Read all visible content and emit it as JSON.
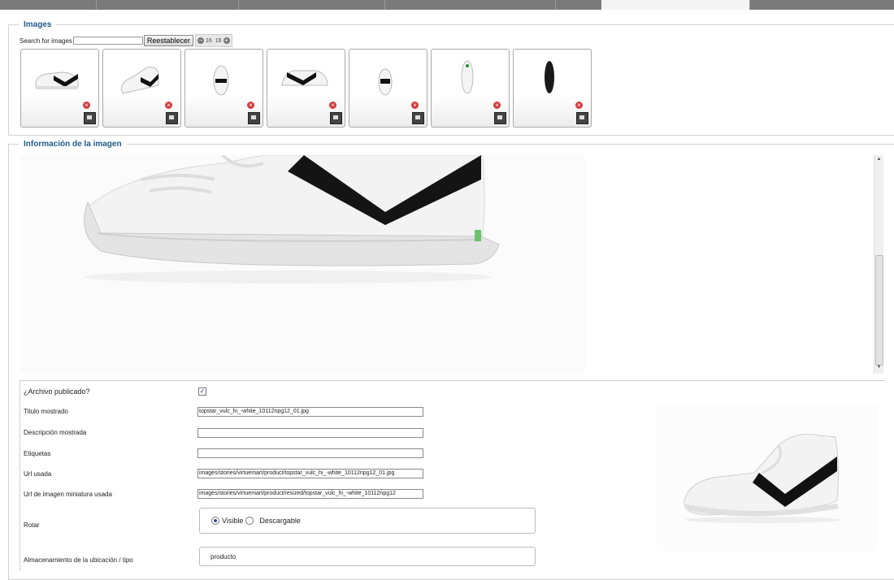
{
  "tabs": [
    "",
    "",
    "",
    "",
    "",
    "",
    ""
  ],
  "images_section": {
    "legend": "Images",
    "search_label": "Search for images",
    "search_value": "",
    "reset_label": "Reestablecer",
    "pager_prev": "−",
    "pager_current": "16",
    "pager_total": "16",
    "pager_next": "+",
    "thumbnails": [
      {
        "name": "shoe-side-view",
        "delete": "×"
      },
      {
        "name": "shoe-angle-view",
        "delete": "×"
      },
      {
        "name": "shoe-front-view",
        "delete": "×"
      },
      {
        "name": "shoe-profile-view",
        "delete": "×"
      },
      {
        "name": "shoe-back-view",
        "delete": "×"
      },
      {
        "name": "shoe-top-view",
        "delete": "×"
      },
      {
        "name": "shoe-sole-view",
        "delete": "×"
      }
    ]
  },
  "info_section": {
    "legend": "Información de la imagen",
    "scroll_up": "▲",
    "scroll_down": "▼"
  },
  "form": {
    "published_label": "¿Archivo publicado?",
    "published_checked": "✓",
    "title_label": "Titulo mostrado",
    "title_value": "topstar_vulc_hi_-white_10112npg12_01.jpg",
    "description_label": "Descripción mostrada",
    "description_value": "",
    "tags_label": "Etiquetas",
    "tags_value": "",
    "url_label": "Url usada",
    "url_value": "images/stories/virtuemart/product/topstar_vulc_hi_-white_10112npg12_01.jpg",
    "thumb_url_label": "Url de imagen miniatura usada",
    "thumb_url_value": "images/stories/virtuemart/product/resized/topstar_vulc_hi_-white_10112npg12",
    "rotate_label": "Rotar",
    "visible_label": "Visible",
    "downloadable_label": "Descargable",
    "storage_label": "Almacenamiento de la ubicación / tipo",
    "storage_value": "producto"
  },
  "colors": {
    "legend": "#1f5a8a",
    "tabbar": "#7a7a7a"
  }
}
